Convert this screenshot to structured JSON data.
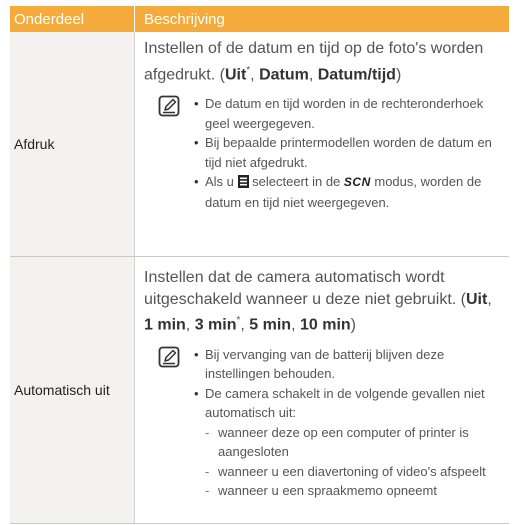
{
  "header": {
    "col1": "Onderdeel",
    "col2": "Beschrijving"
  },
  "rows": [
    {
      "name": "Afdruk",
      "desc_before": "Instellen of de datum en tijd op de foto's worden afgedrukt. (",
      "options": [
        {
          "label": "Uit",
          "mark": "*",
          "sep": ", "
        },
        {
          "label": "Datum",
          "mark": "",
          "sep": ", "
        },
        {
          "label": "Datum/tijd",
          "mark": "",
          "sep": ""
        }
      ],
      "desc_after": ")",
      "icon": "note-icon",
      "bullets": [
        "De datum en tijd worden in de rechteronderhoek geel weergegeven.",
        "Bij bepaalde printermodellen worden de datum en tijd niet afgedrukt."
      ],
      "bullet3": {
        "pre": "Als u ",
        "icon": "menu-icon",
        "mid": " selecteert in de ",
        "mode": "SCN",
        "post": " modus, worden de datum en tijd niet weergegeven."
      }
    },
    {
      "name": "Automatisch uit",
      "desc_before": "Instellen dat de camera automatisch wordt uitgeschakeld wanneer u deze niet gebruikt. (",
      "options": [
        {
          "label": "Uit",
          "mark": "",
          "sep": ", "
        },
        {
          "label": "1 min",
          "mark": "",
          "sep": ", "
        },
        {
          "label": "3 min",
          "mark": "*",
          "sep": ", "
        },
        {
          "label": "5 min",
          "mark": "",
          "sep": ", "
        },
        {
          "label": "10 min",
          "mark": "",
          "sep": ""
        }
      ],
      "desc_after": ")",
      "icon": "note-icon",
      "bullets": [
        "Bij vervanging van de batterij blijven deze instellingen behouden.",
        "De camera schakelt in de volgende gevallen niet automatisch uit:"
      ],
      "dashes": [
        "wanneer deze op een computer of printer is aangesloten",
        "wanneer u een diavertoning of video's afspeelt",
        "wanneer u een spraakmemo opneemt"
      ]
    }
  ],
  "colors": {
    "header_bg": "#f5ab3c",
    "label_bg": "#f3f2f0",
    "divider": "#c9c9c9"
  }
}
